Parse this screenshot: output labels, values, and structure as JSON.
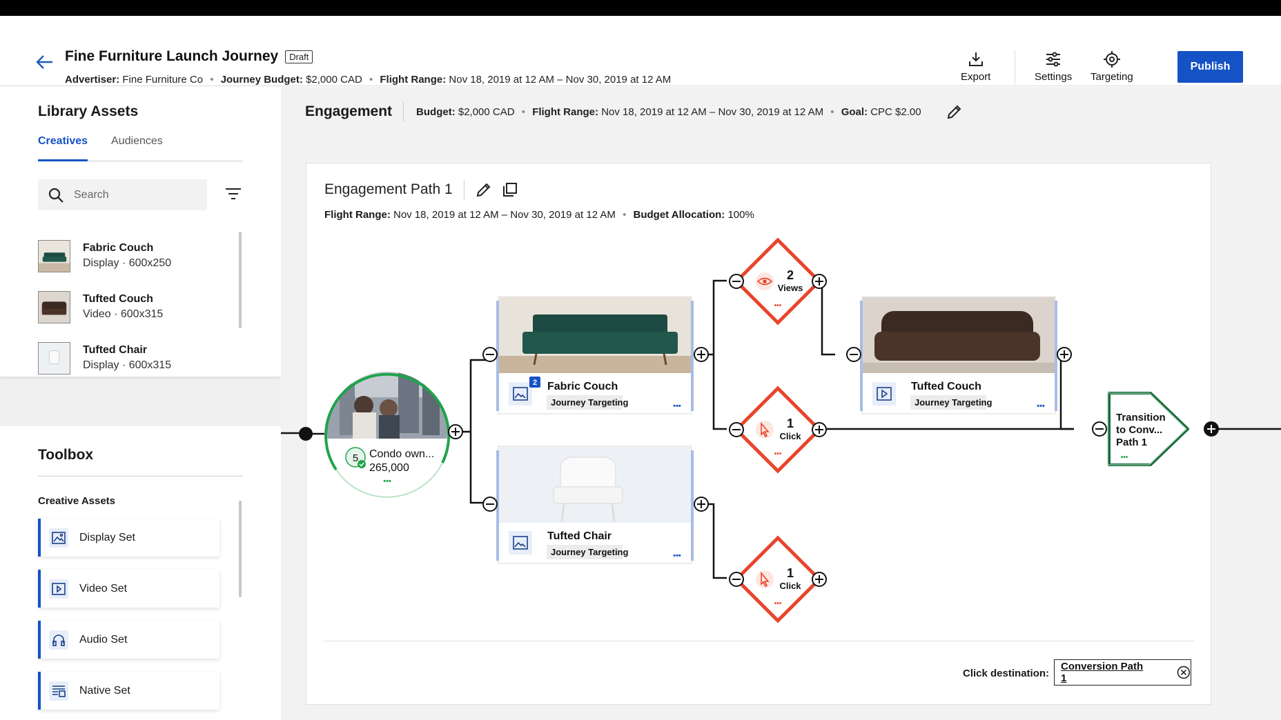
{
  "header": {
    "title": "Fine Furniture Launch Journey",
    "status_badge": "Draft",
    "advertiser_label": "Advertiser:",
    "advertiser_value": "Fine Furniture Co",
    "budget_label": "Journey Budget:",
    "budget_value": "$2,000 CAD",
    "flight_label": "Flight Range:",
    "flight_value": "Nov 18, 2019 at 12 AM – Nov 30, 2019 at 12 AM",
    "export_label": "Export",
    "settings_label": "Settings",
    "targeting_label": "Targeting",
    "publish_label": "Publish"
  },
  "library": {
    "title": "Library Assets",
    "tabs": [
      {
        "label": "Creatives",
        "active": true
      },
      {
        "label": "Audiences",
        "active": false
      }
    ],
    "search_placeholder": "Search",
    "assets": [
      {
        "name": "Fabric Couch",
        "type": "Display",
        "size": "600x250",
        "separator": "·"
      },
      {
        "name": "Tufted Couch",
        "type": "Video",
        "size": "600x315",
        "separator": "·"
      },
      {
        "name": "Tufted Chair",
        "type": "Display",
        "size": "600x315",
        "separator": "·"
      }
    ]
  },
  "toolbox": {
    "title": "Toolbox",
    "section": "Creative Assets",
    "items": [
      {
        "label": "Display Set",
        "icon": "image-icon"
      },
      {
        "label": "Video Set",
        "icon": "play-icon"
      },
      {
        "label": "Audio Set",
        "icon": "headphones-icon"
      },
      {
        "label": "Native Set",
        "icon": "native-icon"
      }
    ]
  },
  "engagement": {
    "title": "Engagement",
    "budget_label": "Budget:",
    "budget_value": "$2,000 CAD",
    "flight_label": "Flight Range:",
    "flight_value": "Nov 18, 2019 at 12 AM – Nov 30, 2019 at 12 AM",
    "goal_label": "Goal:",
    "goal_value": "CPC $2.00"
  },
  "path": {
    "title": "Engagement Path 1",
    "flight_label": "Flight Range:",
    "flight_value": "Nov 18, 2019 at 12 AM – Nov 30, 2019 at 12 AM",
    "allocation_label": "Budget Allocation:",
    "allocation_value": "100%",
    "click_destination_label": "Click destination:",
    "click_destination_value": "Conversion Path 1"
  },
  "flow": {
    "audience": {
      "name": "Condo own...",
      "count": "265,000",
      "badge": "5"
    },
    "cards": [
      {
        "title": "Fabric Couch",
        "tag": "Journey Targeting",
        "badge": "2",
        "icon": "image-icon"
      },
      {
        "title": "Tufted Couch",
        "tag": "Journey Targeting",
        "icon": "play-icon"
      },
      {
        "title": "Tufted Chair",
        "tag": "Journey Targeting",
        "icon": "image-icon"
      }
    ],
    "triggers": [
      {
        "count": "2",
        "label": "Views",
        "icon": "eye-icon"
      },
      {
        "count": "1",
        "label": "Click",
        "icon": "cursor-icon"
      },
      {
        "count": "1",
        "label": "Click",
        "icon": "cursor-icon"
      }
    ],
    "transition": {
      "line1": "Transition",
      "line2": "to Conv...",
      "line3": "Path 1"
    },
    "more": "•••"
  },
  "colors": {
    "brand_blue": "#1552c5",
    "trigger_red": "#e8452c",
    "audience_green": "#1fa34a",
    "transition_green": "#1a6b3a"
  }
}
